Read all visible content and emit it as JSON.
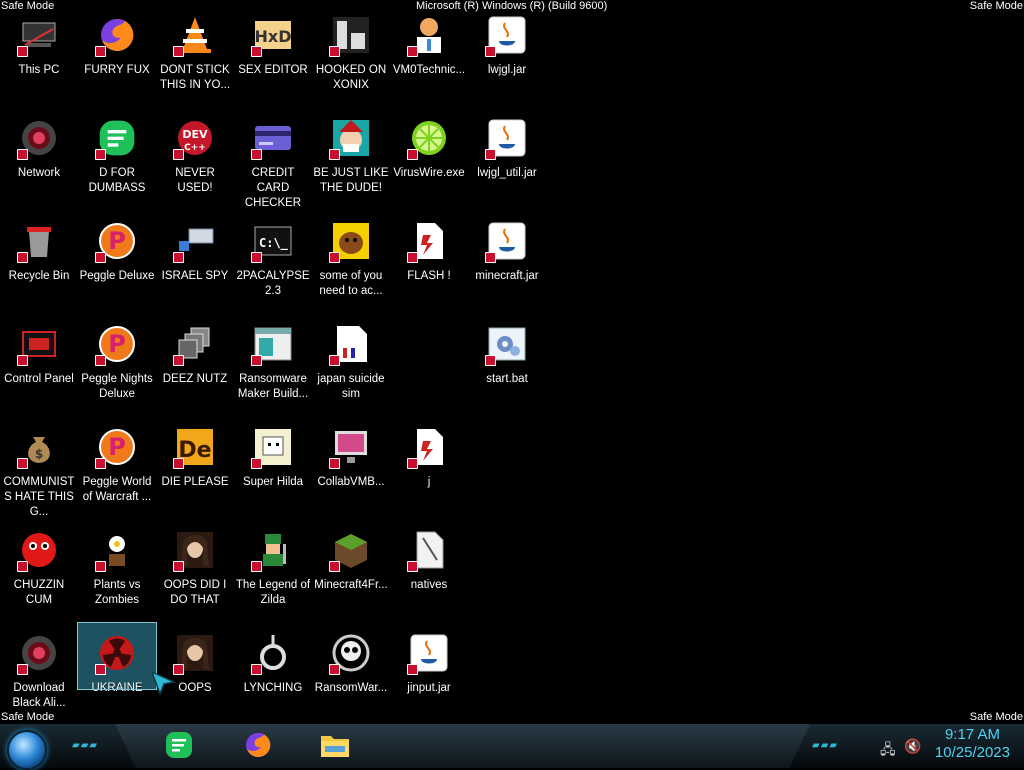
{
  "watermark": {
    "top_left": "Safe Mode",
    "top_center": "Microsoft (R) Windows (R) (Build 9600)",
    "top_right": "Safe Mode",
    "bottom_left": "Safe Mode",
    "bottom_right": "Safe Mode"
  },
  "desktop": {
    "icons": [
      {
        "label": "This PC",
        "icon": "computer-icon"
      },
      {
        "label": "Network",
        "icon": "network-icon"
      },
      {
        "label": "Recycle Bin",
        "icon": "recycle-bin-icon"
      },
      {
        "label": "Control Panel",
        "icon": "control-panel-icon"
      },
      {
        "label": "COMMUNISTS HATE THIS G...",
        "icon": "money-bag-icon"
      },
      {
        "label": "CHUZZIN CUM",
        "icon": "chuzzle-icon"
      },
      {
        "label": "Download Black Ali...",
        "icon": "network-icon"
      },
      {
        "label": "FURRY FUX",
        "icon": "firefox-icon"
      },
      {
        "label": "D FOR DUMBASS",
        "icon": "green-chat-icon"
      },
      {
        "label": "Peggle Deluxe",
        "icon": "peggle-icon"
      },
      {
        "label": "Peggle Nights Deluxe",
        "icon": "peggle-icon"
      },
      {
        "label": "Peggle World of Warcraft ...",
        "icon": "peggle-icon"
      },
      {
        "label": "Plants vs Zombies",
        "icon": "plant-icon"
      },
      {
        "label": "UKRAINE",
        "icon": "radiation-icon"
      },
      {
        "label": "DONT STICK THIS IN YO...",
        "icon": "cone-icon"
      },
      {
        "label": "NEVER USED!",
        "icon": "dev-cpp-icon"
      },
      {
        "label": "ISRAEL SPY",
        "icon": "network-device-icon"
      },
      {
        "label": "DEEZ NUTZ",
        "icon": "stacked-windows-icon"
      },
      {
        "label": "DIE PLEASE",
        "icon": "de-icon"
      },
      {
        "label": "OOPS DID I DO THAT",
        "icon": "portrait-icon"
      },
      {
        "label": "OOPS",
        "icon": "portrait-icon"
      },
      {
        "label": "SEX EDITOR",
        "icon": "hex-editor-icon"
      },
      {
        "label": "CREDIT CARD CHECKER",
        "icon": "credit-card-icon"
      },
      {
        "label": "2PACALYPSE 2.3",
        "icon": "terminal-icon"
      },
      {
        "label": "Ransomware Maker Build...",
        "icon": "window-icon"
      },
      {
        "label": "Super Hilda",
        "icon": "pixel-dog-icon"
      },
      {
        "label": "The Legend of Zilda",
        "icon": "pixel-hero-icon"
      },
      {
        "label": "LYNCHING",
        "icon": "noose-icon"
      },
      {
        "label": "HOOKED ON XONIX",
        "icon": "xonix-icon"
      },
      {
        "label": "BE JUST LIKE THE DUDE!",
        "icon": "elf-icon"
      },
      {
        "label": "some of you need to ac...",
        "icon": "dog-icon"
      },
      {
        "label": "japan suicide sim",
        "icon": "document-icon"
      },
      {
        "label": "CollabVMB...",
        "icon": "monitor-icon"
      },
      {
        "label": "Minecraft4Fr...",
        "icon": "grass-block-icon"
      },
      {
        "label": "RansomWar...",
        "icon": "skull-icon"
      },
      {
        "label": "VM0Technic...",
        "icon": "doctor-icon"
      },
      {
        "label": "VirusWire.exe",
        "icon": "lime-icon"
      },
      {
        "label": "FLASH !",
        "icon": "flash-file-icon"
      },
      {
        "label": "j",
        "icon": "flash-file-icon"
      },
      {
        "label": "natives",
        "icon": "file-icon"
      },
      {
        "label": "jinput.jar",
        "icon": "java-icon"
      },
      {
        "label": "lwjgl.jar",
        "icon": "java-icon"
      },
      {
        "label": "lwjgl_util.jar",
        "icon": "java-icon"
      },
      {
        "label": "minecraft.jar",
        "icon": "java-icon"
      },
      {
        "label": "start.bat",
        "icon": "batch-gear-icon"
      }
    ]
  },
  "taskbar": {
    "apps": [
      {
        "name": "green-chat-icon"
      },
      {
        "name": "firefox-icon"
      },
      {
        "name": "folder-icon"
      }
    ],
    "clock_time": "9:17 AM",
    "clock_date": "10/25/2023"
  }
}
